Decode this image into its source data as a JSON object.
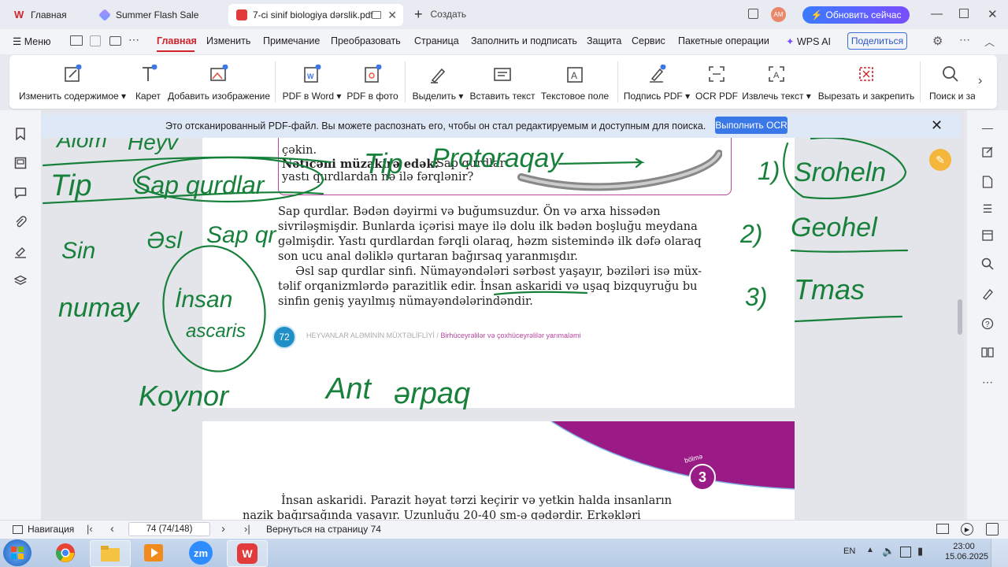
{
  "tabs": [
    {
      "label": "Главная",
      "icon": "wps-logo-icon",
      "color": "#d2232a"
    },
    {
      "label": "Summer Flash Sale",
      "icon": "gem-icon",
      "color": "#7b61ff"
    },
    {
      "label": "7-ci sinif biologiya dərslik.pdf",
      "icon": "pdf-icon",
      "color": "#e23b3b",
      "active": true
    }
  ],
  "create_label": "Создать",
  "avatar_initials": "AM",
  "update_button": "Обновить сейчас",
  "menu": {
    "menu_label": "Меню",
    "items": [
      "Главная",
      "Изменить",
      "Примечание",
      "Преобразовать",
      "Страница",
      "Заполнить и подписать",
      "Защита",
      "Сервис",
      "Пакетные операции"
    ],
    "wps_ai": "WPS AI",
    "share": "Поделиться"
  },
  "ribbon": [
    {
      "label": "Изменить содержимое",
      "icon": "edit-content-icon",
      "dropdown": true
    },
    {
      "label": "Карет",
      "icon": "caret-icon"
    },
    {
      "label": "Добавить изображение",
      "icon": "add-image-icon"
    },
    {
      "label": "PDF в Word",
      "icon": "pdf-to-word-icon",
      "dropdown": true
    },
    {
      "label": "PDF в фото",
      "icon": "pdf-to-photo-icon"
    },
    {
      "label": "Выделить",
      "icon": "highlight-icon",
      "dropdown": true
    },
    {
      "label": "Вставить текст",
      "icon": "insert-text-icon"
    },
    {
      "label": "Текстовое поле",
      "icon": "text-box-icon"
    },
    {
      "label": "Подпись PDF",
      "icon": "pdf-signature-icon",
      "dropdown": true
    },
    {
      "label": "OCR PDF",
      "icon": "ocr-icon"
    },
    {
      "label": "Извлечь текст",
      "icon": "extract-text-icon",
      "dropdown": true
    },
    {
      "label": "Вырезать и закрепить",
      "icon": "cut-pin-icon"
    },
    {
      "label": "Поиск и за",
      "icon": "search-icon"
    }
  ],
  "ocr_bar": {
    "message": "Это отсканированный PDF-файл. Вы можете распознать его, чтобы он стал редактируемым и доступным для поиска.",
    "button": "Выполнить OCR"
  },
  "document": {
    "box_lines": [
      "çəkin.",
      "Nəticəni müzakirə edək:",
      "Sap qurdlar",
      "yastı qurdlardan nə ilə fərqlənir?"
    ],
    "paragraph1": [
      "Sap qurdlar. Bədən dəyirmi və buğumsuzdur. Ön və arxa hissədən",
      "sivriləşmişdir. Bunlarda içərisi maye ilə dolu ilk bədən boşluğu meydana",
      "gəlmişdir. Yastı qurdlardan fərqli olaraq, həzm sistemində ilk dəfə olaraq",
      "son ucu anal dəliklə qurtaran bağırsaq yaranmışdır."
    ],
    "paragraph2": [
      "Əsl sap qurdlar sinfi. Nümayəndələri sərbəst yaşayır, bəziləri isə müx-",
      "təlif orqanizmlərdə parazitlik edir. İnsan askaridi və uşaq bizquyruğu bu",
      "sinfin geniş yayılmış nümayəndələrindəndir."
    ],
    "page_number": "72",
    "footer_left": "HEYVANLAR ALƏMİNİN MÜXTƏLİFLİYİ /",
    "footer_right": "Birhüceyrəlilər və çoxhüceyrəlilər yarımaləmi",
    "section_label": "bölmə",
    "section_number": "3",
    "page2_line1": "İnsan askaridi. Parazit həyat tərzi keçirir və yetkin halda insanların",
    "page2_line2": "nazik bağırsağında yaşayır. Uzunluğu 20-40 sm-ə qədərdir. Erkəkləri",
    "handwriting": [
      "Alom",
      "Heyv",
      "Tip",
      "Sap qurdlar",
      "Sin",
      "Əsl",
      "Sap qr",
      "numay",
      "İnsan",
      "ascaris",
      "Koynor",
      "Ant",
      "ərpaq",
      "Tip",
      "Protoraqay",
      "1)",
      "Sroheln",
      "2)",
      "Geohel",
      "3)",
      "Tmas"
    ]
  },
  "status": {
    "navigation": "Навигация",
    "page_value": "74 (74/148)",
    "return_text": "Вернуться на страницу 74"
  },
  "taskbar": {
    "lang": "EN",
    "time": "23:00",
    "date": "15.06.2025"
  },
  "colors": {
    "accent_red": "#d2232a",
    "ink_green": "#17803a",
    "magenta": "#9b1b86"
  }
}
